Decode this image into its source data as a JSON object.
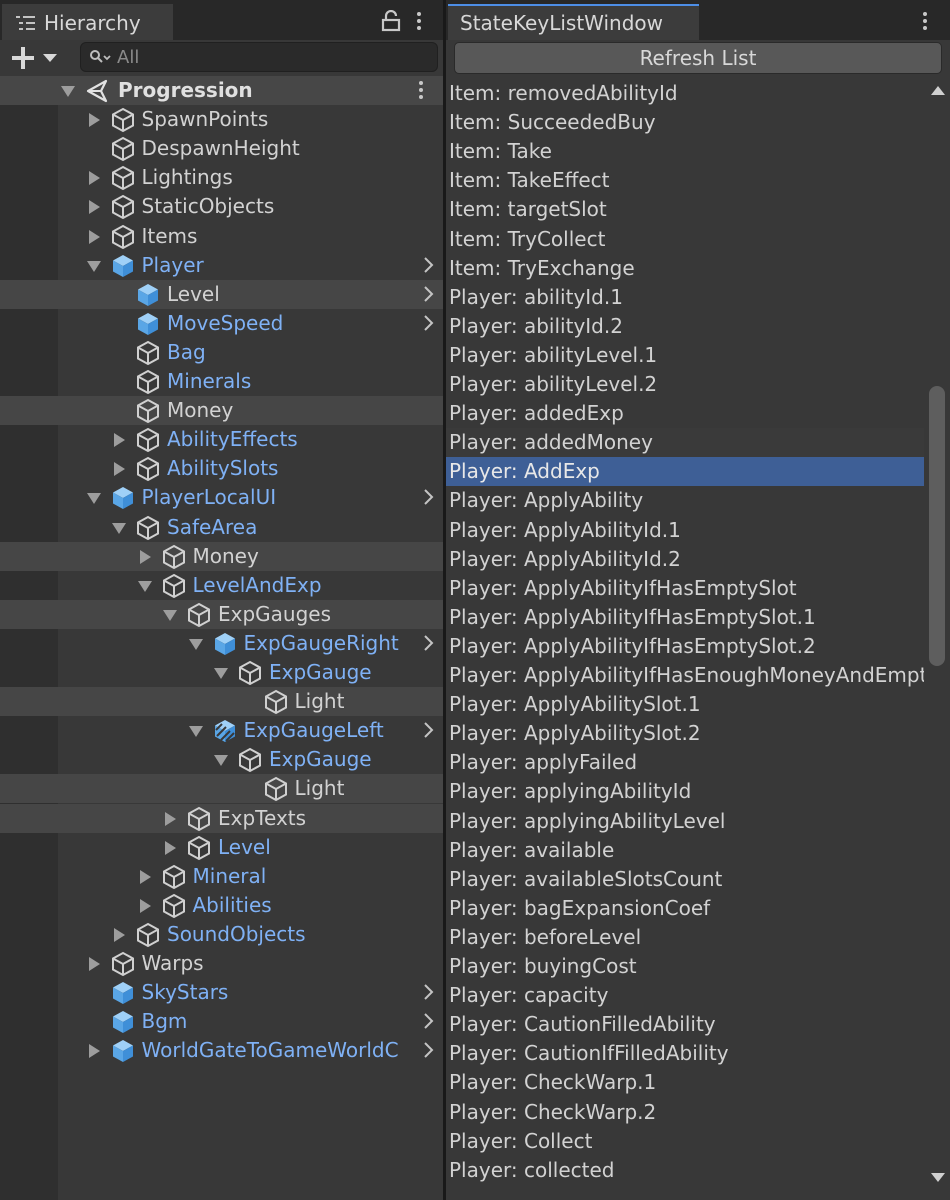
{
  "colors": {
    "panel": "#383838",
    "tab_bg": "#282828",
    "prefab_text": "#7fb1f5",
    "selection": "#3e5f96",
    "text": "#d2d2d2"
  },
  "hierarchy": {
    "tab_title": "Hierarchy",
    "tab_icon": "list-icon",
    "search_placeholder": "All",
    "rows": [
      {
        "label": "Progression",
        "depth": 0,
        "fold": "open",
        "icon": "unity-scene-icon",
        "kind": "scene",
        "arrow": false,
        "hl": true,
        "kebab": true
      },
      {
        "label": "SpawnPoints",
        "depth": 1,
        "fold": "closed",
        "icon": "gameobject-icon",
        "kind": "normal",
        "arrow": false,
        "hl": false
      },
      {
        "label": "DespawnHeight",
        "depth": 1,
        "fold": "none",
        "icon": "gameobject-icon",
        "kind": "normal",
        "arrow": false,
        "hl": false
      },
      {
        "label": "Lightings",
        "depth": 1,
        "fold": "closed",
        "icon": "gameobject-icon",
        "kind": "normal",
        "arrow": false,
        "hl": false
      },
      {
        "label": "StaticObjects",
        "depth": 1,
        "fold": "closed",
        "icon": "gameobject-icon",
        "kind": "normal",
        "arrow": false,
        "hl": false
      },
      {
        "label": "Items",
        "depth": 1,
        "fold": "closed",
        "icon": "gameobject-icon",
        "kind": "normal",
        "arrow": false,
        "hl": false
      },
      {
        "label": "Player",
        "depth": 1,
        "fold": "open",
        "icon": "prefab-icon",
        "kind": "prefab",
        "arrow": true,
        "hl": false
      },
      {
        "label": "Level",
        "depth": 2,
        "fold": "none",
        "icon": "prefab-icon",
        "kind": "normal",
        "arrow": true,
        "hl": true
      },
      {
        "label": "MoveSpeed",
        "depth": 2,
        "fold": "none",
        "icon": "prefab-icon",
        "kind": "prefab",
        "arrow": true,
        "hl": false
      },
      {
        "label": "Bag",
        "depth": 2,
        "fold": "none",
        "icon": "gameobject-icon",
        "kind": "prefab",
        "arrow": false,
        "hl": false
      },
      {
        "label": "Minerals",
        "depth": 2,
        "fold": "none",
        "icon": "gameobject-icon",
        "kind": "prefab",
        "arrow": false,
        "hl": false
      },
      {
        "label": "Money",
        "depth": 2,
        "fold": "none",
        "icon": "gameobject-icon",
        "kind": "normal",
        "arrow": false,
        "hl": true
      },
      {
        "label": "AbilityEffects",
        "depth": 2,
        "fold": "closed",
        "icon": "gameobject-icon",
        "kind": "prefab",
        "arrow": false,
        "hl": false
      },
      {
        "label": "AbilitySlots",
        "depth": 2,
        "fold": "closed",
        "icon": "gameobject-icon",
        "kind": "prefab",
        "arrow": false,
        "hl": false
      },
      {
        "label": "PlayerLocalUI",
        "depth": 1,
        "fold": "open",
        "icon": "prefab-icon",
        "kind": "prefab",
        "arrow": true,
        "hl": false
      },
      {
        "label": "SafeArea",
        "depth": 2,
        "fold": "open",
        "icon": "gameobject-icon",
        "kind": "prefab",
        "arrow": false,
        "hl": false
      },
      {
        "label": "Money",
        "depth": 3,
        "fold": "closed",
        "icon": "gameobject-icon",
        "kind": "normal",
        "arrow": false,
        "hl": true
      },
      {
        "label": "LevelAndExp",
        "depth": 3,
        "fold": "open",
        "icon": "gameobject-icon",
        "kind": "prefab",
        "arrow": false,
        "hl": false
      },
      {
        "label": "ExpGauges",
        "depth": 4,
        "fold": "open",
        "icon": "gameobject-icon",
        "kind": "normal",
        "arrow": false,
        "hl": true
      },
      {
        "label": "ExpGaugeRight",
        "depth": 5,
        "fold": "open",
        "icon": "prefab-icon",
        "kind": "prefab",
        "arrow": true,
        "hl": false
      },
      {
        "label": "ExpGauge",
        "depth": 6,
        "fold": "open",
        "icon": "gameobject-icon",
        "kind": "prefab",
        "arrow": false,
        "hl": false
      },
      {
        "label": "Light",
        "depth": 7,
        "fold": "none",
        "icon": "gameobject-icon",
        "kind": "normal",
        "arrow": false,
        "hl": true
      },
      {
        "label": "ExpGaugeLeft",
        "depth": 5,
        "fold": "open",
        "icon": "prefab-variant-icon",
        "kind": "prefab",
        "arrow": true,
        "hl": false
      },
      {
        "label": "ExpGauge",
        "depth": 6,
        "fold": "open",
        "icon": "gameobject-icon",
        "kind": "prefab",
        "arrow": false,
        "hl": false
      },
      {
        "label": "Light",
        "depth": 7,
        "fold": "none",
        "icon": "gameobject-icon",
        "kind": "normal",
        "arrow": false,
        "hl": true
      },
      {
        "label": "ExpTexts",
        "depth": 4,
        "fold": "closed",
        "icon": "gameobject-icon",
        "kind": "normal",
        "arrow": false,
        "hl": true
      },
      {
        "label": "Level",
        "depth": 4,
        "fold": "closed",
        "icon": "gameobject-icon",
        "kind": "prefab",
        "arrow": false,
        "hl": false
      },
      {
        "label": "Mineral",
        "depth": 3,
        "fold": "closed",
        "icon": "gameobject-icon",
        "kind": "prefab",
        "arrow": false,
        "hl": false
      },
      {
        "label": "Abilities",
        "depth": 3,
        "fold": "closed",
        "icon": "gameobject-icon",
        "kind": "prefab",
        "arrow": false,
        "hl": false
      },
      {
        "label": "SoundObjects",
        "depth": 2,
        "fold": "closed",
        "icon": "gameobject-icon",
        "kind": "prefab",
        "arrow": false,
        "hl": false
      },
      {
        "label": "Warps",
        "depth": 1,
        "fold": "closed",
        "icon": "gameobject-icon",
        "kind": "normal",
        "arrow": false,
        "hl": false
      },
      {
        "label": "SkyStars",
        "depth": 1,
        "fold": "none",
        "icon": "prefab-icon",
        "kind": "prefab",
        "arrow": true,
        "hl": false
      },
      {
        "label": "Bgm",
        "depth": 1,
        "fold": "none",
        "icon": "prefab-icon",
        "kind": "prefab",
        "arrow": true,
        "hl": false
      },
      {
        "label": "WorldGateToGameWorldC",
        "depth": 1,
        "fold": "closed",
        "icon": "prefab-icon",
        "kind": "prefab",
        "arrow": true,
        "hl": false
      }
    ]
  },
  "state_keys": {
    "tab_title": "StateKeyListWindow",
    "refresh_label": "Refresh List",
    "items": [
      "Item: removedAbilityId",
      "Item: SucceededBuy",
      "Item: Take",
      "Item: TakeEffect",
      "Item: targetSlot",
      "Item: TryCollect",
      "Item: TryExchange",
      "Player: abilityId.1",
      "Player: abilityId.2",
      "Player: abilityLevel.1",
      "Player: abilityLevel.2",
      "Player: addedExp",
      "Player: addedMoney",
      "Player: AddExp",
      "Player: ApplyAbility",
      "Player: ApplyAbilityId.1",
      "Player: ApplyAbilityId.2",
      "Player: ApplyAbilityIfHasEmptySlot",
      "Player: ApplyAbilityIfHasEmptySlot.1",
      "Player: ApplyAbilityIfHasEmptySlot.2",
      "Player: ApplyAbilityIfHasEnoughMoneyAndEmptySlot",
      "Player: ApplyAbilitySlot.1",
      "Player: ApplyAbilitySlot.2",
      "Player: applyFailed",
      "Player: applyingAbilityId",
      "Player: applyingAbilityLevel",
      "Player: available",
      "Player: availableSlotsCount",
      "Player: bagExpansionCoef",
      "Player: beforeLevel",
      "Player: buyingCost",
      "Player: capacity",
      "Player: CautionFilledAbility",
      "Player: CautionIfFilledAbility",
      "Player: CheckWarp.1",
      "Player: CheckWarp.2",
      "Player: Collect",
      "Player: collected"
    ],
    "selected_index": 13,
    "hover_index": 12
  }
}
